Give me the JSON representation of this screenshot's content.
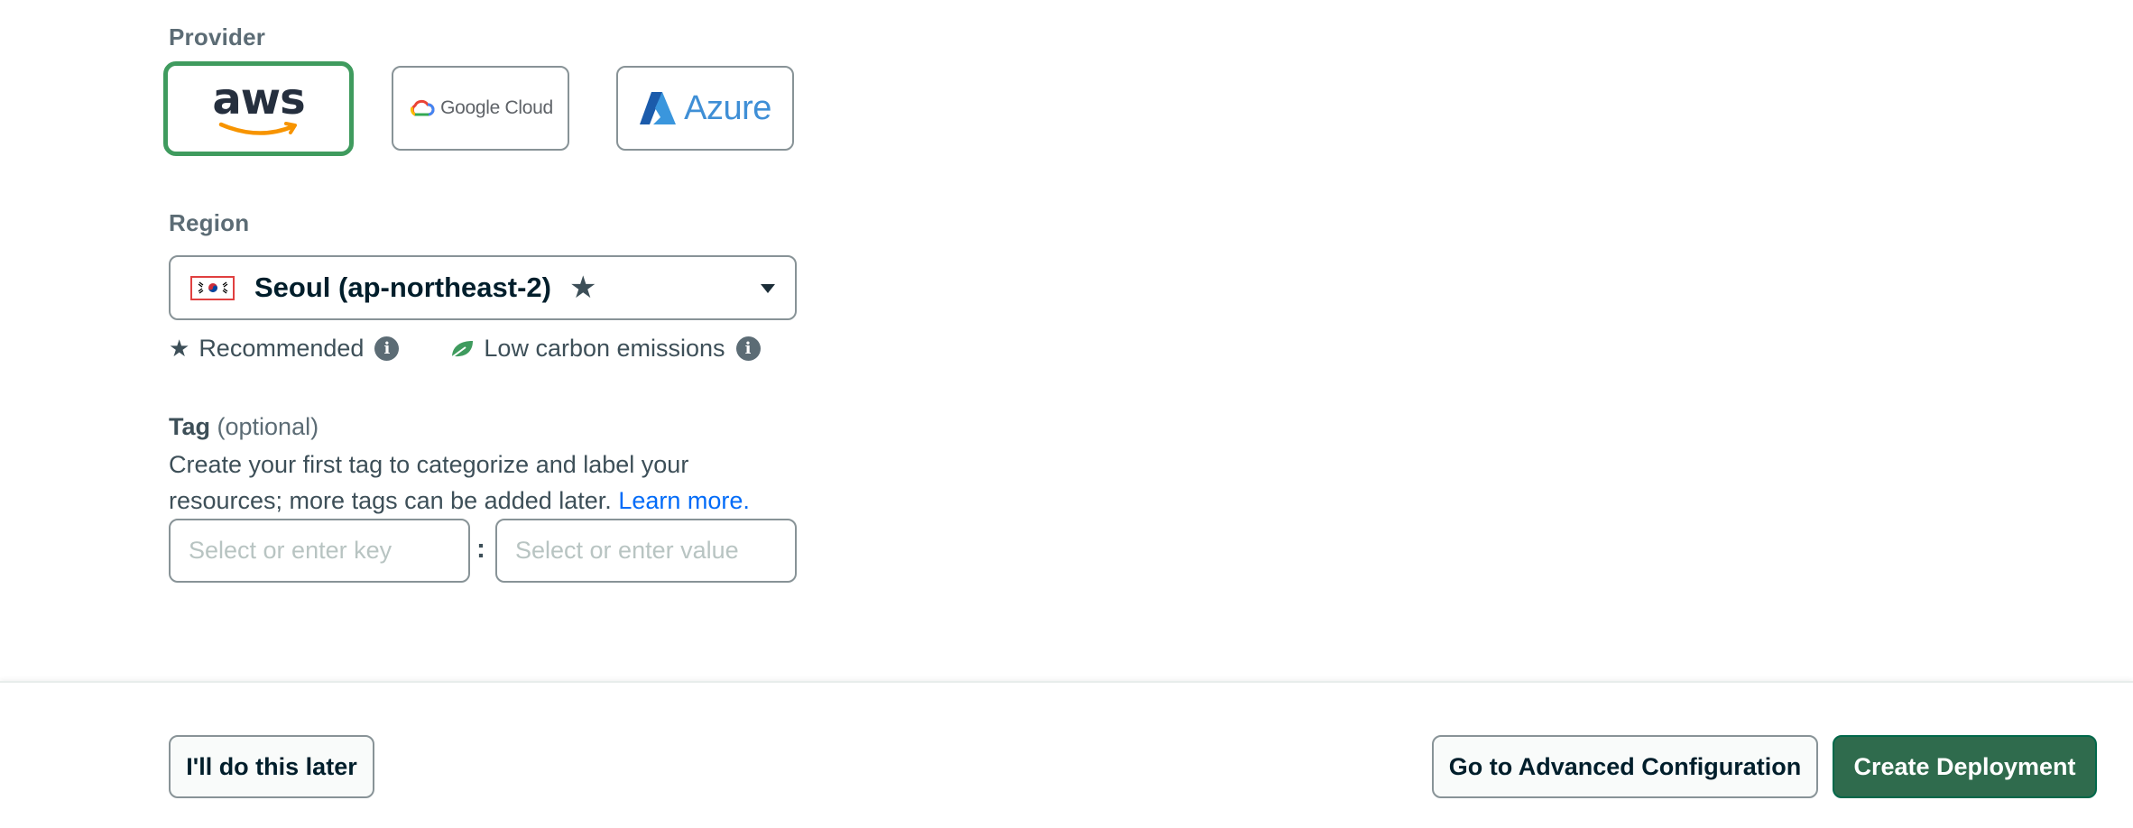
{
  "provider": {
    "label": "Provider",
    "options": [
      {
        "name": "aws",
        "text": "aws",
        "selected": true
      },
      {
        "name": "google-cloud",
        "text": "Google Cloud",
        "selected": false
      },
      {
        "name": "azure",
        "text": "Azure",
        "selected": false
      }
    ]
  },
  "region": {
    "label": "Region",
    "selected_value": "Seoul (ap-northeast-2)",
    "recommended": true
  },
  "legend": {
    "recommended_label": "Recommended",
    "low_carbon_label": "Low carbon emissions"
  },
  "tag": {
    "title": "Tag",
    "optional": "(optional)",
    "description": "Create your first tag to categorize and label your resources; more tags can be added later.",
    "learn_more": "Learn more.",
    "key_placeholder": "Select or enter key",
    "separator": ":",
    "value_placeholder": "Select or enter value"
  },
  "footer": {
    "later_label": "I'll do this later",
    "advanced_label": "Go to Advanced Configuration",
    "create_label": "Create Deployment"
  },
  "colors": {
    "selected_border": "#3f9b5e",
    "primary_button": "#2f6b4d",
    "link": "#016bf8",
    "leaf": "#3f9b5e"
  }
}
